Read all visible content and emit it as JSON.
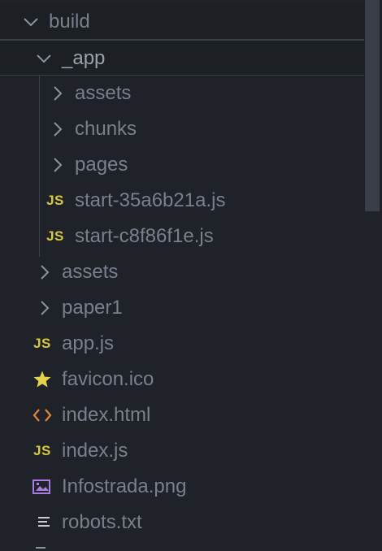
{
  "tree": {
    "build": {
      "label": "build",
      "icon": "chevron-down-icon"
    },
    "app_dir": {
      "label": "_app",
      "icon": "chevron-down-icon"
    },
    "app_children": [
      {
        "label": "assets",
        "icon": "chevron-right-icon"
      },
      {
        "label": "chunks",
        "icon": "chevron-right-icon"
      },
      {
        "label": "pages",
        "icon": "chevron-right-icon"
      },
      {
        "label": "start-35a6b21a.js",
        "icon": "js-icon",
        "icon_text": "JS"
      },
      {
        "label": "start-c8f86f1e.js",
        "icon": "js-icon",
        "icon_text": "JS"
      }
    ],
    "build_children": [
      {
        "label": "assets",
        "icon": "chevron-right-icon"
      },
      {
        "label": "paper1",
        "icon": "chevron-right-icon"
      },
      {
        "label": "app.js",
        "icon": "js-icon",
        "icon_text": "JS"
      },
      {
        "label": "favicon.ico",
        "icon": "star-icon"
      },
      {
        "label": "index.html",
        "icon": "code-icon"
      },
      {
        "label": "index.js",
        "icon": "js-icon",
        "icon_text": "JS"
      },
      {
        "label": "Infostrada.png",
        "icon": "image-icon"
      },
      {
        "label": "robots.txt",
        "icon": "text-lines-icon"
      }
    ]
  },
  "colors": {
    "background": "#1f2329",
    "text": "#78808d",
    "js": "#d7c83f",
    "star": "#e4d24a",
    "html": "#e0863a",
    "image": "#a77ee0"
  }
}
